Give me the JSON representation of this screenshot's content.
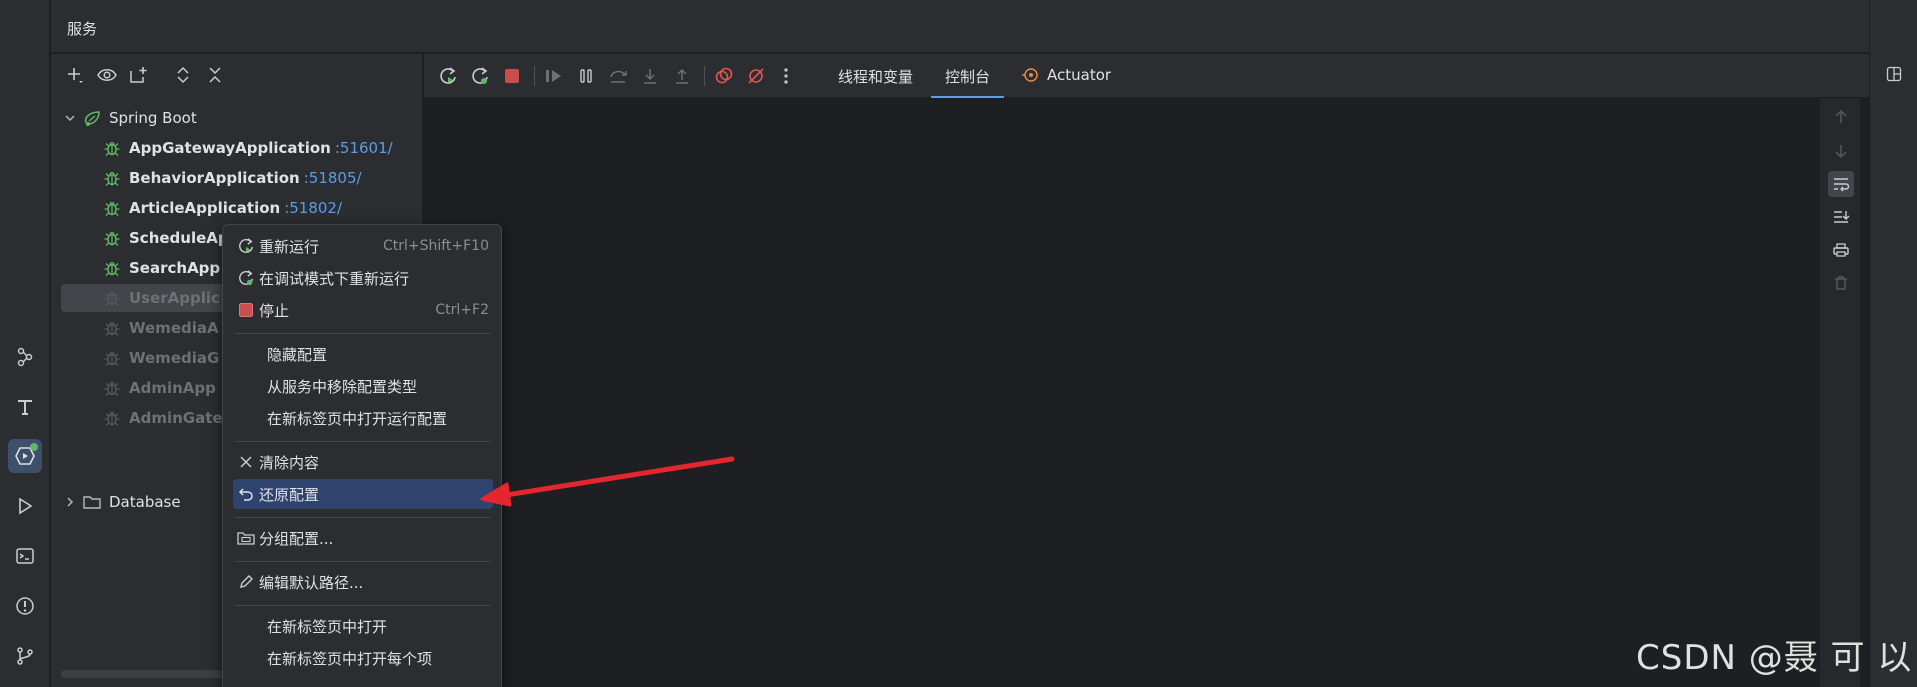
{
  "panel": {
    "title": "服务"
  },
  "tree": {
    "root_label": "Spring Boot",
    "apps": [
      {
        "name": "AppGatewayApplication",
        "port": ":51601/"
      },
      {
        "name": "BehaviorApplication",
        "port": ":51805/"
      },
      {
        "name": "ArticleApplication",
        "port": ":51802/"
      },
      {
        "name": "ScheduleAp",
        "port": ""
      },
      {
        "name": "SearchApp",
        "port": ""
      },
      {
        "name": "UserApplic",
        "port": ""
      },
      {
        "name": "WemediaA",
        "port": ""
      },
      {
        "name": "WemediaG",
        "port": ""
      },
      {
        "name": "AdminApp",
        "port": ""
      },
      {
        "name": "AdminGate",
        "port": ""
      }
    ],
    "database_label": "Database"
  },
  "console": {
    "tabs": [
      {
        "label": "线程和变量"
      },
      {
        "label": "控制台"
      },
      {
        "label": "Actuator"
      }
    ]
  },
  "context_menu": {
    "items": [
      {
        "label": "重新运行",
        "shortcut": "Ctrl+Shift+F10",
        "icon": "rerun-icon"
      },
      {
        "label": "在调试模式下重新运行",
        "shortcut": "",
        "icon": "rerun-debug-icon"
      },
      {
        "label": "停止",
        "shortcut": "Ctrl+F2",
        "icon": "stop-icon"
      },
      {
        "label": "隐藏配置",
        "shortcut": "",
        "icon": ""
      },
      {
        "label": "从服务中移除配置类型",
        "shortcut": "",
        "icon": ""
      },
      {
        "label": "在新标签页中打开运行配置",
        "shortcut": "",
        "icon": ""
      },
      {
        "label": "清除内容",
        "shortcut": "",
        "icon": "close-icon"
      },
      {
        "label": "还原配置",
        "shortcut": "",
        "icon": "undo-icon"
      },
      {
        "label": "分组配置...",
        "shortcut": "",
        "icon": "group-icon"
      },
      {
        "label": "编辑默认路径...",
        "shortcut": "",
        "icon": "pencil-icon"
      },
      {
        "label": "在新标签页中打开",
        "shortcut": "",
        "icon": ""
      },
      {
        "label": "在新标签页中打开每个项",
        "shortcut": "",
        "icon": ""
      }
    ]
  },
  "watermark": "CSDN @聂 可 以",
  "colors": {
    "accent": "#5a9ee8",
    "menu_highlight": "#2e436e",
    "spring_green": "#5fb865",
    "stop_red": "#c94f4f",
    "arrow_red": "#e5262e"
  }
}
